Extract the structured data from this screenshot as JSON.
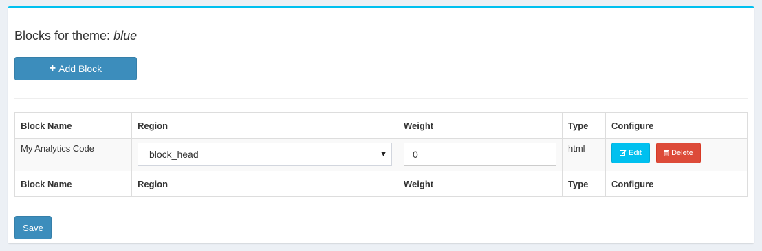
{
  "page": {
    "title_prefix": "Blocks for theme: ",
    "theme_name": "blue"
  },
  "toolbar": {
    "add_block_label": "Add Block",
    "add_icon": "plus-icon"
  },
  "table": {
    "columns": [
      "Block Name",
      "Region",
      "Weight",
      "Type",
      "Configure"
    ],
    "rows": [
      {
        "block_name": "My Analytics Code",
        "region": "block_head",
        "weight": "0",
        "type": "html",
        "edit_label": "Edit",
        "delete_label": "Delete"
      }
    ]
  },
  "footer": {
    "save_label": "Save"
  },
  "colors": {
    "accent": "#00c0ef",
    "primary": "#3c8dbc",
    "danger": "#dd4b39"
  }
}
